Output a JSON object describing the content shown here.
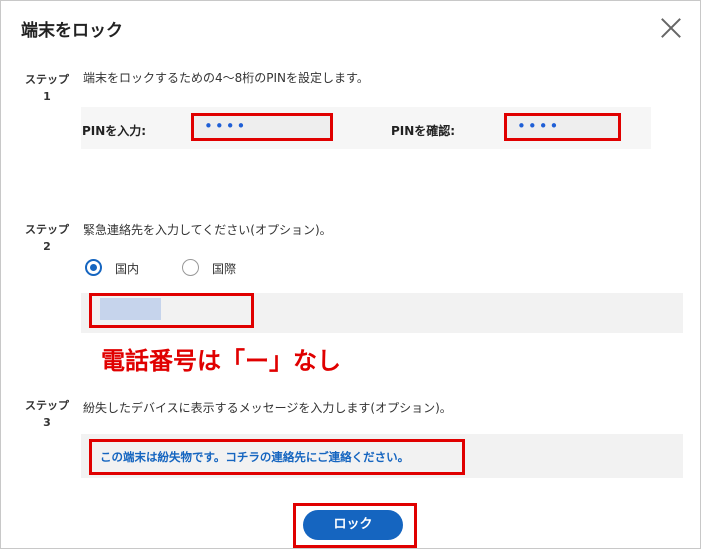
{
  "dialog": {
    "title": "端末をロック",
    "close_icon": "close-icon"
  },
  "step1": {
    "label": "ステップ",
    "number": "1",
    "description": "端末をロックするための4～8桁のPINを設定します。",
    "pin_label": "PINを入力:",
    "pin_value": "••••",
    "pin_confirm_label": "PINを確認:",
    "pin_confirm_value": "••••"
  },
  "step2": {
    "label": "ステップ",
    "number": "2",
    "description": "緊急連絡先を入力してください(オプション)。",
    "radio_domestic": "国内",
    "radio_international": "国際",
    "selected": "国内",
    "phone_value": ""
  },
  "annotation": "電話番号は「ー」なし",
  "step3": {
    "label": "ステップ",
    "number": "3",
    "description": "紛失したデバイスに表示するメッセージを入力します(オプション)。",
    "message_value": "この端末は紛失物です。コチラの連絡先にご連絡ください。"
  },
  "actions": {
    "lock_label": "ロック"
  },
  "colors": {
    "accent": "#1565c0",
    "highlight": "#e00000"
  }
}
